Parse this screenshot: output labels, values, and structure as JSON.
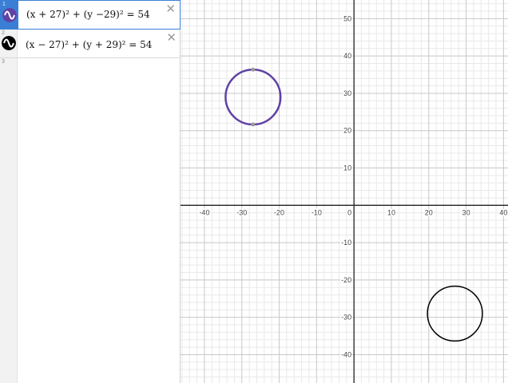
{
  "expressions": [
    {
      "index": "1",
      "latex": "(x + 27)² + (y −29)² = 54",
      "color": "#6042a6",
      "active": true,
      "icon": "wave-icon",
      "close_label": "✕"
    },
    {
      "index": "2",
      "latex": "(x − 27)² + (y + 29)² = 54",
      "color": "#000000",
      "active": false,
      "icon": "wave-icon",
      "close_label": "✕"
    },
    {
      "index": "3",
      "latex": ""
    }
  ],
  "graph": {
    "x_ticks": [
      "-40",
      "-30",
      "-20",
      "-10",
      "0",
      "10",
      "20",
      "30",
      "40"
    ],
    "y_ticks": [
      "50",
      "40",
      "30",
      "20",
      "10",
      "-10",
      "-20",
      "-30",
      "-40"
    ],
    "x_range": [
      -46.4,
      41.2
    ],
    "y_range": [
      -47.6,
      55.0
    ],
    "grid": true,
    "minor_step": 2,
    "major_step": 10
  },
  "curves": [
    {
      "name": "circle-1",
      "h": -27,
      "k": 29,
      "r2": 54,
      "color": "#6042a6",
      "selected": true
    },
    {
      "name": "circle-2",
      "h": 27,
      "k": -29,
      "r2": 54,
      "color": "#000000",
      "selected": false
    }
  ]
}
